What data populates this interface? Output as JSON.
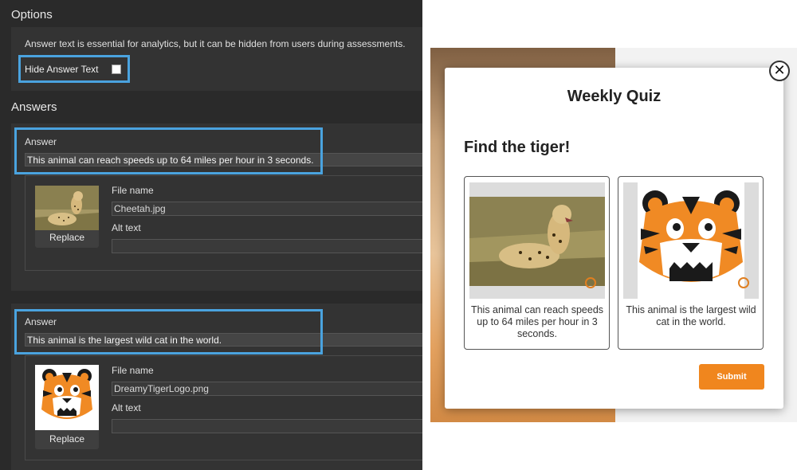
{
  "options": {
    "title": "Options",
    "hint": "Answer text is essential for analytics, but it can be hidden from users during assessments.",
    "hide_answer_label": "Hide Answer Text",
    "hide_answer_checked": false
  },
  "answers_title": "Answers",
  "answers": [
    {
      "label": "Answer",
      "text": "This animal can reach speeds up to 64 miles per hour in 3 seconds.",
      "file_name_label": "File name",
      "file_name": "Cheetah.jpg",
      "alt_text_label": "Alt text",
      "alt_text": "",
      "replace_label": "Replace",
      "thumb_icon": "cheetah-photo"
    },
    {
      "label": "Answer",
      "text": "This animal is the largest wild cat in the world.",
      "file_name_label": "File name",
      "file_name": "DreamyTigerLogo.png",
      "alt_text_label": "Alt text",
      "alt_text": "",
      "replace_label": "Replace",
      "thumb_icon": "tiger-logo"
    }
  ],
  "quiz": {
    "close_symbol": "✕",
    "title": "Weekly Quiz",
    "question": "Find the tiger!",
    "choices": [
      {
        "caption": "This animal can reach speeds up to 64 miles per hour in 3 seconds.",
        "image": "cheetah-photo"
      },
      {
        "caption": "This animal is the largest wild cat in the world.",
        "image": "tiger-logo"
      }
    ],
    "submit_label": "Submit"
  },
  "colors": {
    "highlight": "#4aa3df",
    "accent": "#f0861e",
    "editor_bg": "#2a2a2a"
  }
}
